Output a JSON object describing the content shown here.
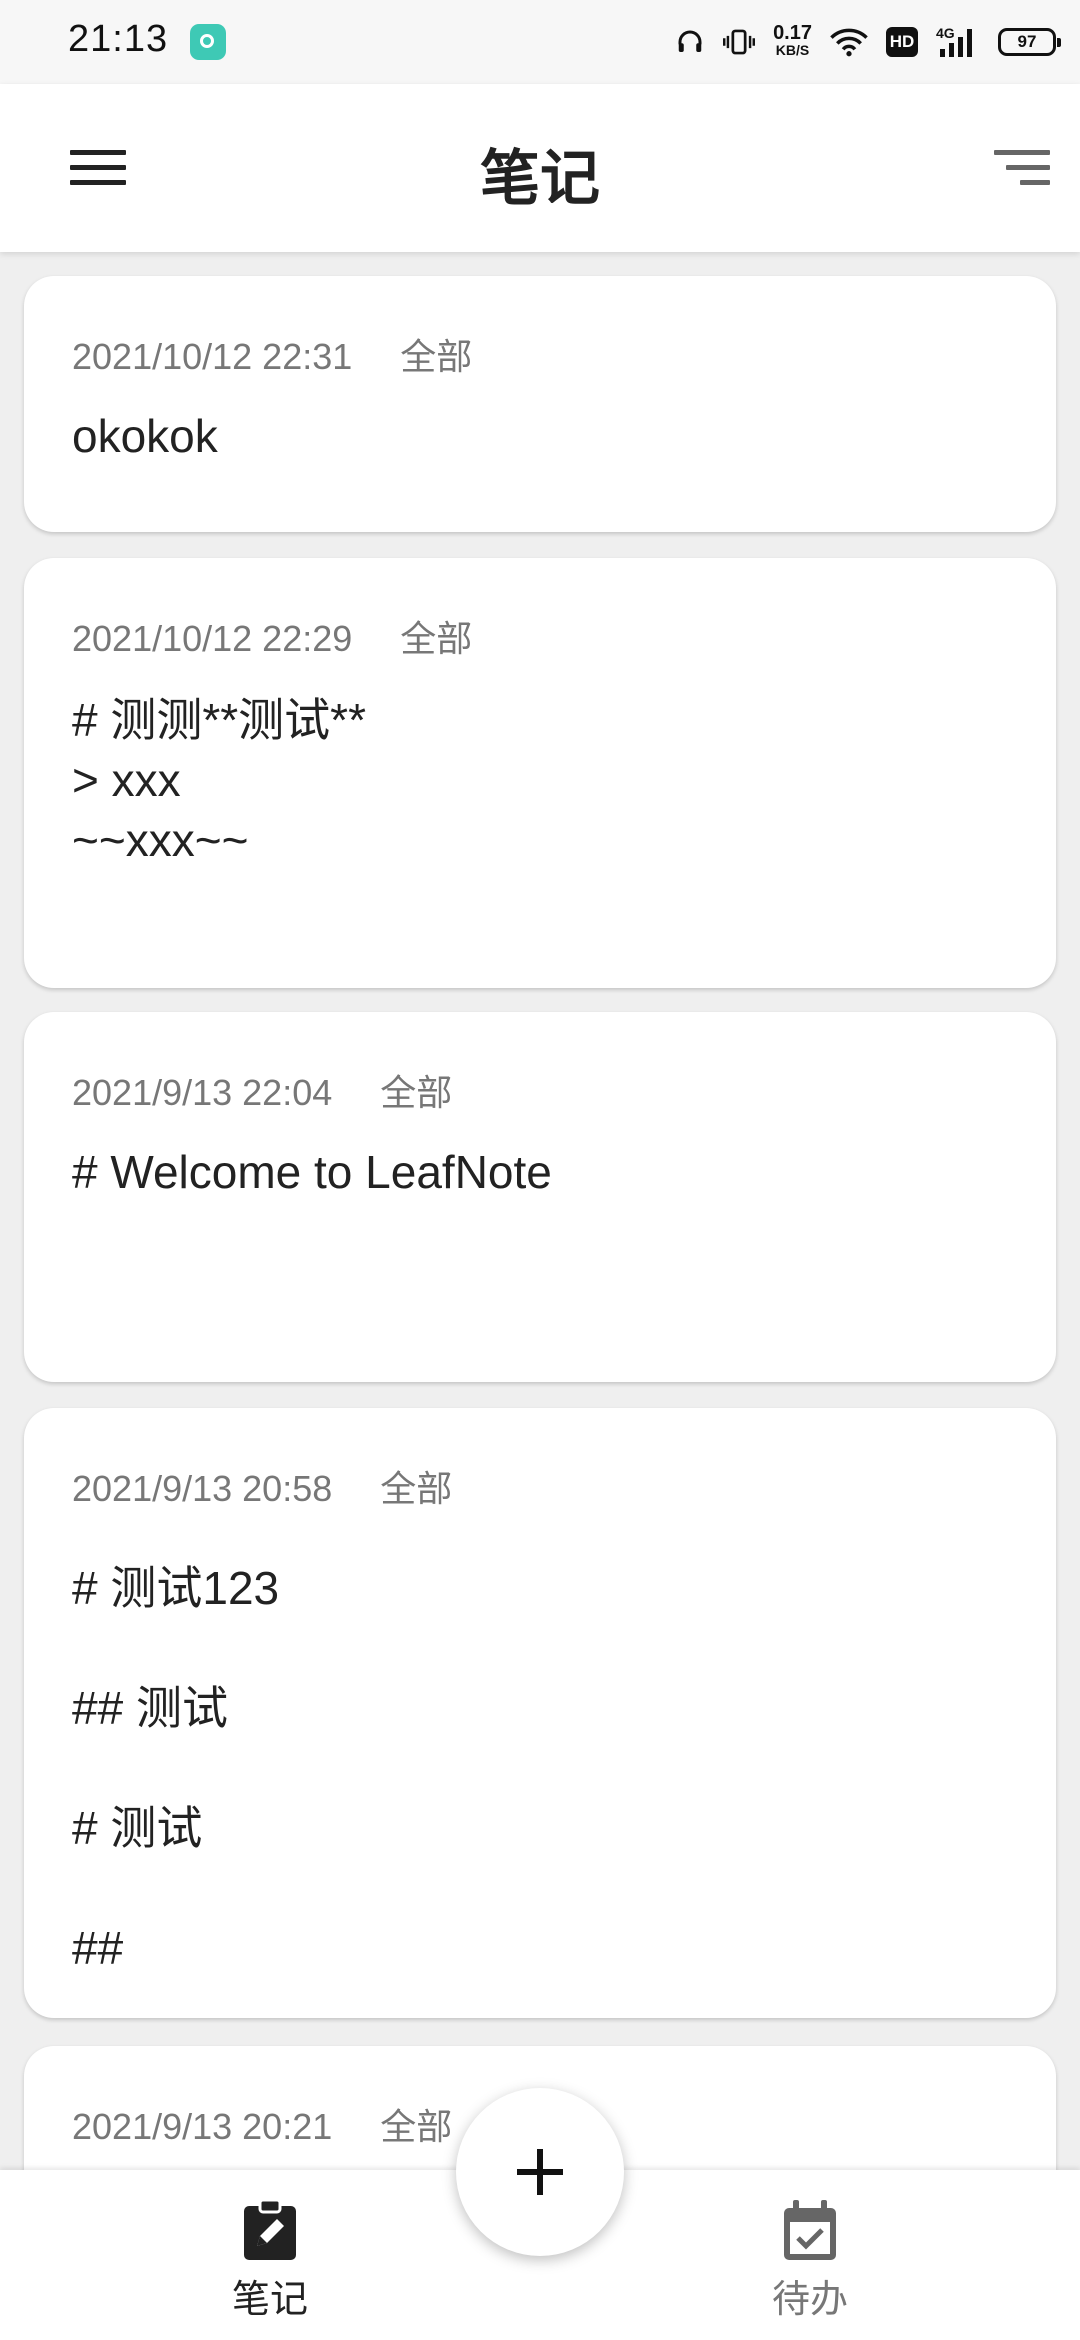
{
  "status_bar": {
    "time": "21:13",
    "net_speed_value": "0.17",
    "net_speed_unit": "KB/S",
    "hd_label": "HD",
    "network_label": "4G",
    "battery_level": "97",
    "icons": [
      "app-icon",
      "headphones-icon",
      "vibrate-icon",
      "wifi-icon",
      "signal-icon",
      "battery-icon"
    ]
  },
  "app_bar": {
    "title": "笔记",
    "left_icon": "menu-icon",
    "right_icon": "sort-icon"
  },
  "notes": [
    {
      "date": "2021/10/12 22:31",
      "folder": "全部",
      "body": "okokok"
    },
    {
      "date": "2021/10/12 22:29",
      "folder": "全部",
      "body": "# 测测**测试**\n> xxx\n~~xxx~~"
    },
    {
      "date": "2021/9/13 22:04",
      "folder": "全部",
      "body": "# Welcome to LeafNote"
    },
    {
      "date": "2021/9/13 20:58",
      "folder": "全部",
      "body": "# 测试123\n## 测试\n# 测试\n##"
    },
    {
      "date": "2021/9/13 20:21",
      "folder": "全部",
      "body": ""
    }
  ],
  "bottom_nav": {
    "items": [
      {
        "label": "笔记",
        "icon": "edit-clipboard-icon",
        "active": true
      },
      {
        "label": "待办",
        "icon": "calendar-check-icon",
        "active": false
      }
    ],
    "fab_icon": "plus-icon"
  },
  "colors": {
    "background": "#efefef",
    "card": "#ffffff",
    "meta_text": "#777777",
    "accent_app_icon": "#3ec9b5"
  }
}
